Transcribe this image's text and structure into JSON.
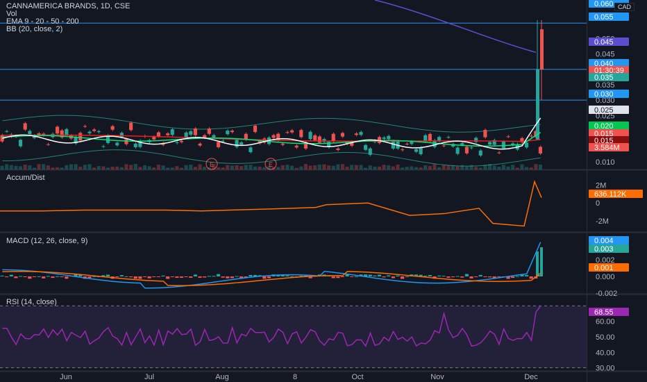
{
  "header": {
    "symbol": "CANNAMERICA BRANDS, 1D, CSE",
    "vol_label": "Vol",
    "ema_label": "EMA 9 - 20 - 50 - 200",
    "bb_label": "BB (20, close, 2)",
    "currency": "CAD"
  },
  "panes": {
    "accum_title": "Accum/Dist",
    "macd_title": "MACD (12, 26, close, 9)",
    "rsi_title": "RSI (14, close)"
  },
  "colors": {
    "background": "#131722",
    "up": "#26a69a",
    "down": "#ef5350",
    "ema9": "#ffffff",
    "ema20": "#00e676",
    "ema50": "#e91e1e",
    "ema200": "#5b4fcf",
    "bb": "#2a9d8f",
    "hline": "#2196f3",
    "accum": "#ff6d00",
    "macd": "#2196f3",
    "signal": "#ff6d00",
    "rsi": "#9c27b0"
  },
  "chart_data": [
    {
      "type": "candlestick",
      "title": "CANNAMERICA BRANDS, 1D, CSE",
      "y_ticks": [
        "0.050",
        "0.045",
        "0.035",
        "0.030",
        "0.025",
        "0.020",
        "0.015",
        "0.010"
      ],
      "x_ticks": [
        "Jun",
        "Jul",
        "Aug",
        "8",
        "Oct",
        "Nov",
        "Dec"
      ],
      "horizontal_lines": [
        0.055,
        0.04,
        0.03
      ],
      "earnings_markers": [
        "E",
        "E"
      ],
      "price_labels": [
        {
          "text": "0.060",
          "color": "#2196f3"
        },
        {
          "text": "0.055",
          "color": "#2196f3"
        },
        {
          "text": "0.045",
          "color": "#5b4fcf"
        },
        {
          "text": "0.040",
          "color": "#2196f3"
        },
        {
          "text": "01:30:39",
          "color": "#ef5350"
        },
        {
          "text": "0.035",
          "color": "#26a69a"
        },
        {
          "text": "0.030",
          "color": "#2196f3"
        },
        {
          "text": "0.025",
          "color": "#e0e3eb"
        },
        {
          "text": "0.020",
          "color": "#00c853"
        },
        {
          "text": "0.015",
          "color": "#ef5350"
        },
        {
          "text": "0.015",
          "color": "#880e10"
        },
        {
          "text": "3.584M",
          "color": "#ef5350"
        }
      ],
      "close_approx": {
        "before_breakout": [
          0.018,
          0.019,
          0.02,
          0.018,
          0.019,
          0.02,
          0.018,
          0.017,
          0.019,
          0.018,
          0.015,
          0.014,
          0.016,
          0.015
        ],
        "final_candles": [
          {
            "open": 0.02,
            "high": 0.055,
            "low": 0.018,
            "close": 0.04
          },
          {
            "open": 0.05,
            "high": 0.055,
            "low": 0.03,
            "close": 0.04
          }
        ]
      }
    },
    {
      "type": "line",
      "title": "Accum/Dist",
      "y_ticks": [
        "2M",
        "0",
        "-2M"
      ],
      "last_value_label": "636.112K",
      "series": [
        {
          "name": "Accum/Dist",
          "values_millions": [
            -0.9,
            -0.9,
            -0.8,
            -0.8,
            -0.8,
            -0.9,
            -0.8,
            -0.7,
            -0.6,
            -0.5,
            -0.2,
            0.0,
            -1.4,
            -1.2,
            -0.6,
            -2.3,
            -2.6,
            2.4,
            0.6
          ]
        }
      ]
    },
    {
      "type": "line",
      "title": "MACD (12, 26, close, 9)",
      "y_ticks": [
        "0.002",
        "0.000",
        "-0.002"
      ],
      "value_labels": [
        "0.004",
        "0.003",
        "0.001"
      ],
      "series": [
        {
          "name": "MACD",
          "last": 0.004
        },
        {
          "name": "Signal",
          "last": 0.001
        },
        {
          "name": "Histogram",
          "last": 0.003
        }
      ]
    },
    {
      "type": "line",
      "title": "RSI (14, close)",
      "y_ticks": [
        "60.00",
        "50.00",
        "40.00",
        "30.00"
      ],
      "last_value_label": "68.55",
      "bands": [
        70,
        30
      ],
      "ylim": [
        28,
        76
      ]
    }
  ]
}
